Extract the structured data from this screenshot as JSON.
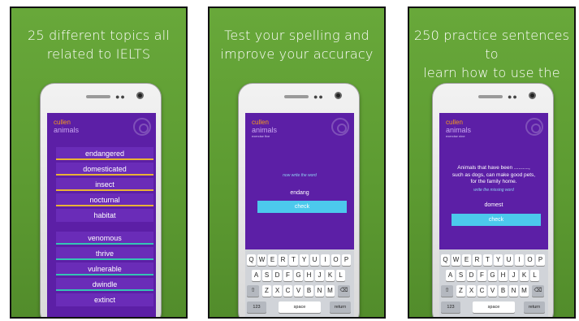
{
  "panels": [
    {
      "caption_line1": "25 different topics all",
      "caption_line2": "related to IELTS",
      "brand": "cullen",
      "topic": "animals",
      "words_group1": [
        "endangered",
        "domesticated",
        "insect",
        "nocturnal",
        "habitat"
      ],
      "words_group2": [
        "venomous",
        "thrive",
        "vulnerable",
        "dwindle",
        "extinct"
      ]
    },
    {
      "caption_line1": "Test your spelling and",
      "caption_line2": "improve your accuracy",
      "brand": "cullen",
      "topic": "animals",
      "subtitle": "exercise five",
      "prompt": "now write the word",
      "answer": "endang",
      "check": "check"
    },
    {
      "caption_line1": "250 practice sentences to",
      "caption_line2": "learn how to use the words",
      "brand": "cullen",
      "topic": "animals",
      "subtitle": "exercise nine",
      "sentence_line1": "Animals that have been ..........,",
      "sentence_line2": "such as dogs, can make good pets,",
      "sentence_line3": "for the family home.",
      "prompt": "write the missing word",
      "answer": "domest",
      "check": "check"
    }
  ],
  "keyboard": {
    "row1": [
      "Q",
      "W",
      "E",
      "R",
      "T",
      "Y",
      "U",
      "I",
      "O",
      "P"
    ],
    "row2": [
      "A",
      "S",
      "D",
      "F",
      "G",
      "H",
      "J",
      "K",
      "L"
    ],
    "row3": [
      "Z",
      "X",
      "C",
      "V",
      "B",
      "N",
      "M"
    ],
    "shift": "⇧",
    "backspace": "⌫",
    "num": "123",
    "space": "space",
    "return": "return"
  }
}
